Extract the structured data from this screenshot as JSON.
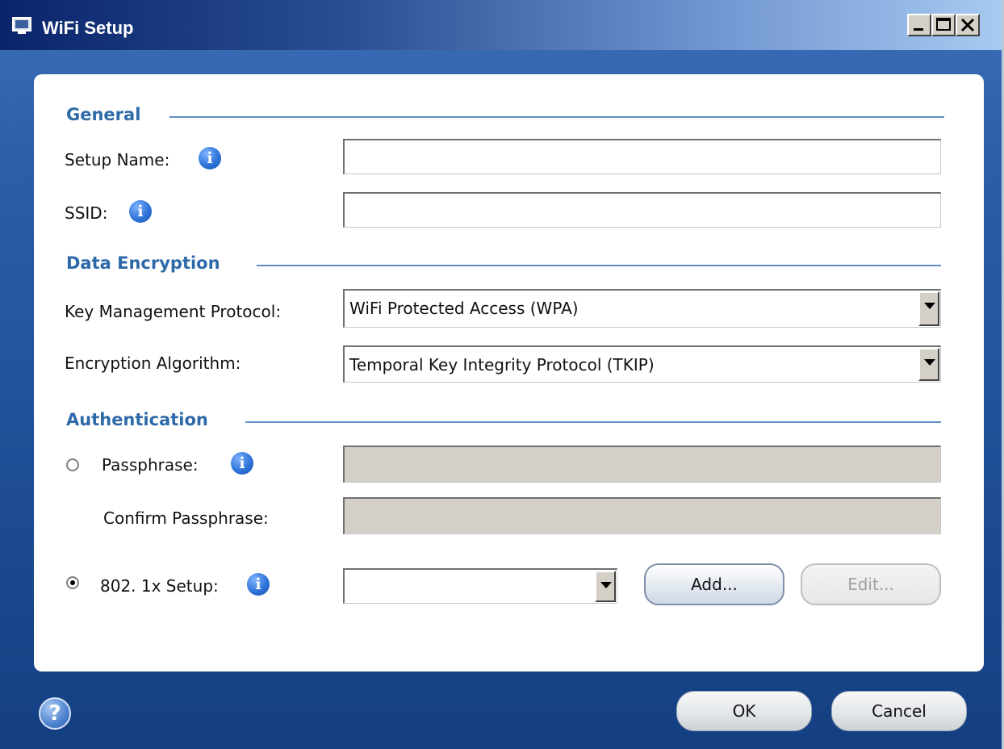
{
  "window": {
    "title": "WiFi Setup"
  },
  "general": {
    "heading": "General",
    "setup_name_label": "Setup Name:",
    "setup_name_value": "",
    "ssid_label": "SSID:",
    "ssid_value": ""
  },
  "encryption": {
    "heading": "Data Encryption",
    "kmp_label": "Key Management Protocol:",
    "kmp_value": "WiFi Protected Access (WPA)",
    "algo_label": "Encryption Algorithm:",
    "algo_value": "Temporal Key Integrity Protocol (TKIP)"
  },
  "authentication": {
    "heading": "Authentication",
    "passphrase_label": "Passphrase:",
    "passphrase_selected": false,
    "passphrase_value": "",
    "confirm_label": "Confirm Passphrase:",
    "confirm_value": "",
    "dot1x_label": "802. 1x Setup:",
    "dot1x_selected": true,
    "dot1x_value": "",
    "add_label": "Add...",
    "edit_label": "Edit..."
  },
  "footer": {
    "ok_label": "OK",
    "cancel_label": "Cancel",
    "help_symbol": "?"
  },
  "icons": {
    "window_icon": "network-setup-icon",
    "info_icon": "info-icon",
    "help_icon": "help-icon"
  },
  "colors": {
    "section_heading": "#2e6aa8",
    "window_background": "#1f4f96",
    "info_icon": "#2f74d8"
  }
}
